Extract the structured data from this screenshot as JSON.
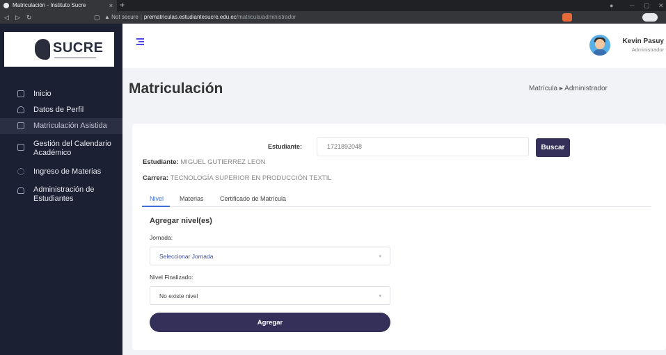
{
  "browser": {
    "tab_title": "Matriculación - Instituto Sucre",
    "tab_close": "×",
    "new_tab": "+",
    "security": "Not secure",
    "url_host": "prematriculas.estudiantesucre.edu.ec",
    "url_path": "/matricula/administrador"
  },
  "sidebar": {
    "logo_text": "SUCRE",
    "items": [
      {
        "label": "Inicio",
        "icon": "grid-icon"
      },
      {
        "label": "Datos de Perfil",
        "icon": "person-icon"
      },
      {
        "label": "Matriculación Asistida",
        "icon": "user-box-icon"
      },
      {
        "label": "Gestión del Calendario Académico",
        "icon": "calendar-icon"
      },
      {
        "label": "Ingreso de Materias",
        "icon": "gear-icon"
      },
      {
        "label": "Administración de Estudiantes",
        "icon": "person-icon"
      }
    ]
  },
  "header": {
    "user_name": "Kevin Pasuy",
    "user_role": "Administrador"
  },
  "page": {
    "title": "Matriculación",
    "breadcrumb": "Matrícula ▸ Administrador"
  },
  "form": {
    "estudiante_label": "Estudiante:",
    "cedula_value": "1721892048",
    "buscar_label": "Buscar",
    "student_label": "Estudiante:",
    "student_value": "MIGUEL GUTIERREZ LEON",
    "career_label": "Carrera:",
    "career_value": "TECNOLOGÍA SUPERIOR EN PRODUCCIÓN TEXTIL"
  },
  "tabs": [
    {
      "label": "Nivel",
      "active": true
    },
    {
      "label": "Materias",
      "active": false
    },
    {
      "label": "Certificado de Matrícula",
      "active": false
    }
  ],
  "nivel": {
    "section_title": "Agregar nivel(es)",
    "jornada_label": "Jornada:",
    "jornada_value": "Seleccionar Jornada",
    "nivel_label": "Nivel Finalizado:",
    "nivel_value": "No existe nivel",
    "agregar_label": "Agregar"
  },
  "colors": {
    "sidebar_bg": "#1c2033",
    "primary_button": "#34305a",
    "active_tab": "#3f6fd8"
  }
}
